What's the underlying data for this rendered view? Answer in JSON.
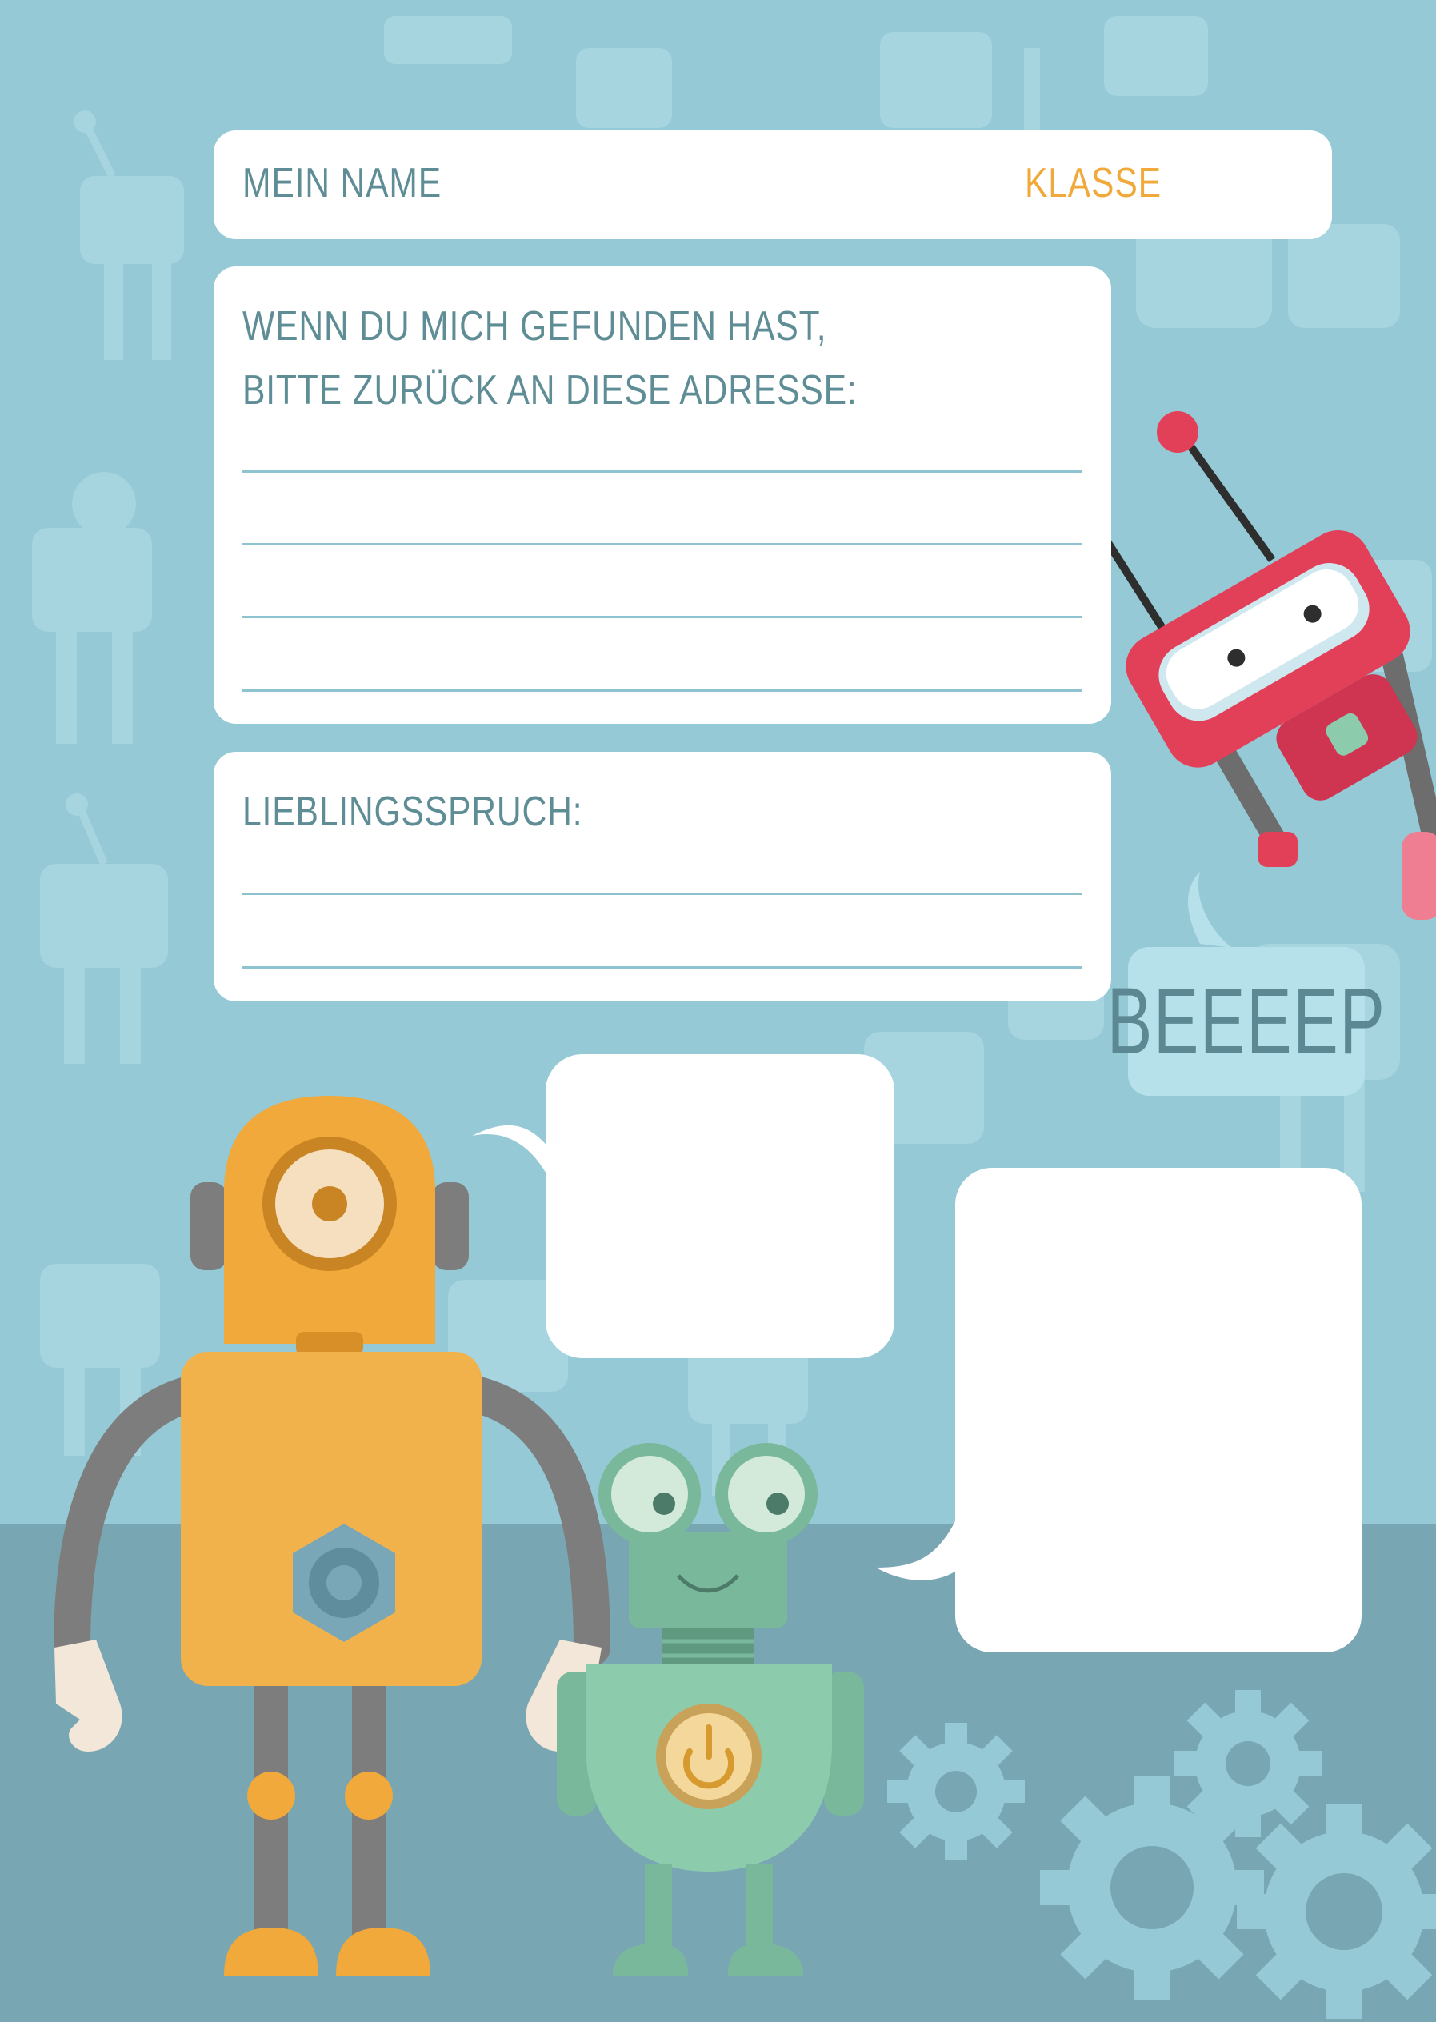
{
  "header": {
    "name_label": "MEIN NAME",
    "class_label": "KLASSE"
  },
  "address_card": {
    "line1": "WENN DU MICH GEFUNDEN HAST,",
    "line2": "BITTE ZURÜCK AN DIESE ADRESSE:"
  },
  "motto_card": {
    "label": "LIEBLINGSSPRUCH:"
  },
  "speech": {
    "beep": "BEEEEP"
  },
  "colors": {
    "background": "#95c9d6",
    "floor": "#79a6b3",
    "label_text": "#5f8d96",
    "accent_orange": "#f0a93a"
  }
}
